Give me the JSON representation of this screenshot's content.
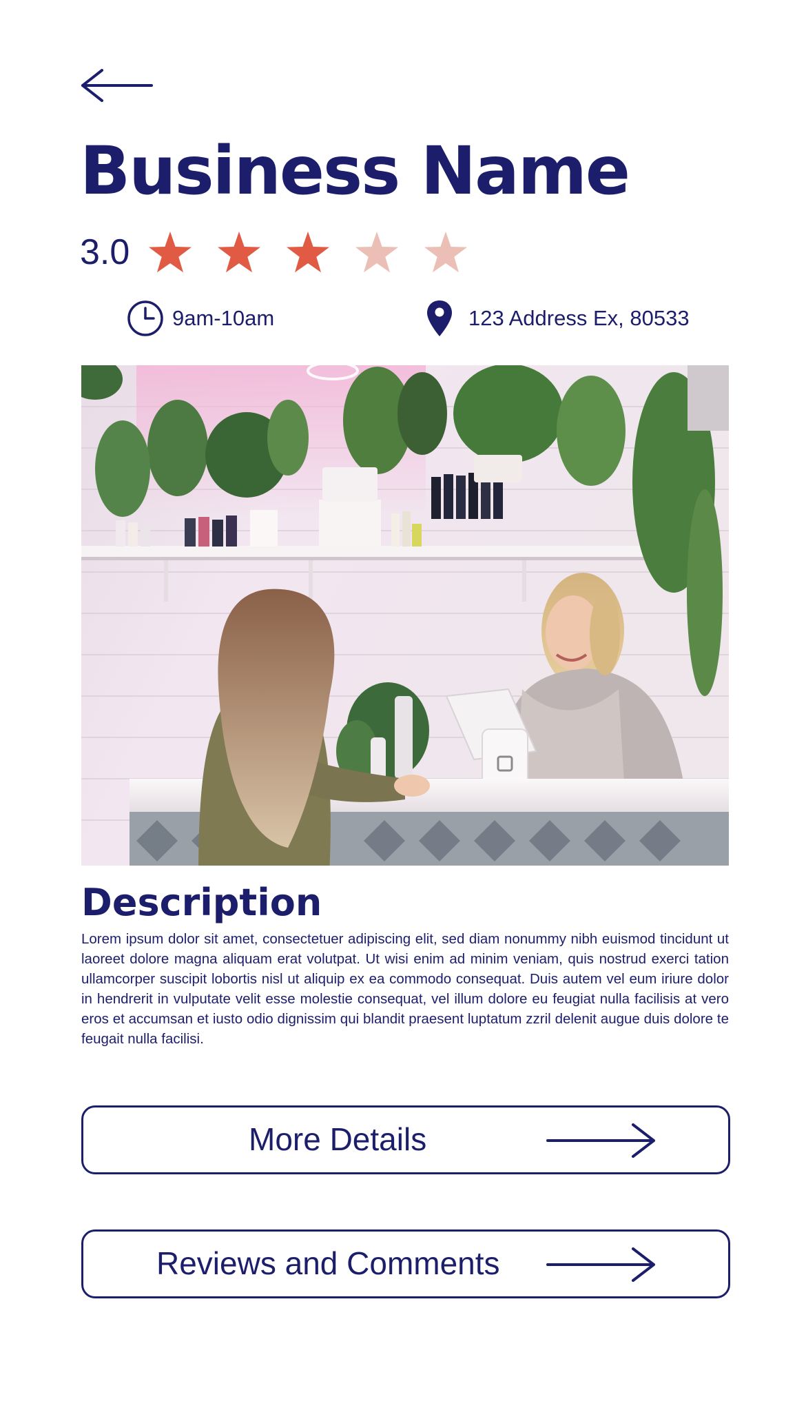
{
  "header": {
    "back_icon": "arrow-left-icon",
    "title": "Business Name"
  },
  "rating": {
    "value": "3.0",
    "score": 3,
    "max": 5,
    "filled_color": "#e05a44",
    "empty_color": "#ebbfb5"
  },
  "info": {
    "hours_icon": "clock-icon",
    "hours": "9am-10am",
    "address_icon": "map-pin-icon",
    "address": "123 Address Ex, 80533"
  },
  "photo": {
    "subject": "photo"
  },
  "description": {
    "heading": "Description",
    "body": "Lorem ipsum dolor sit amet, consectetuer adipiscing elit, sed diam nonummy nibh euismod tincidunt ut laoreet dolore magna aliquam erat volutpat. Ut wisi enim ad minim veniam, quis nostrud exerci tation ullamcorper suscipit lobortis nisl ut aliquip ex ea commodo consequat. Duis autem vel eum iriure dolor in hendrerit in vulputate velit esse molestie consequat, vel illum dolore eu feugiat nulla facilisis at vero eros et accumsan et iusto odio dignissim qui blandit praesent luptatum zzril delenit augue duis dolore te feugait nulla facilisi."
  },
  "actions": {
    "more_details_label": "More Details",
    "reviews_label": "Reviews and Comments",
    "arrow_icon": "arrow-right-icon"
  },
  "colors": {
    "primary": "#1c1e6b",
    "accent": "#e05a44",
    "background": "#ffffff"
  }
}
